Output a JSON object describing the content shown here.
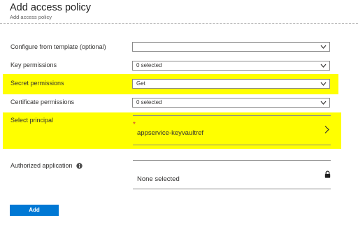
{
  "header": {
    "title": "Add access policy",
    "subtitle": "Add access policy"
  },
  "form": {
    "template": {
      "label": "Configure from template (optional)",
      "value": ""
    },
    "key_permissions": {
      "label": "Key permissions",
      "value": "0 selected"
    },
    "secret_permissions": {
      "label": "Secret permissions",
      "value": "Get"
    },
    "certificate_permissions": {
      "label": "Certificate permissions",
      "value": "0 selected"
    },
    "principal": {
      "label": "Select principal",
      "required_mark": "*",
      "value": "appservice-keyvaultref"
    },
    "authorized_application": {
      "label": "Authorized application",
      "value": "None selected"
    }
  },
  "actions": {
    "add_label": "Add"
  },
  "colors": {
    "highlight": "#ffff00",
    "accent": "#0078d4",
    "required": "#d13438"
  },
  "icons": {
    "dropdown": "chevron-down-icon",
    "principal_nav": "chevron-right-icon",
    "info": "info-icon",
    "lock": "lock-icon"
  }
}
